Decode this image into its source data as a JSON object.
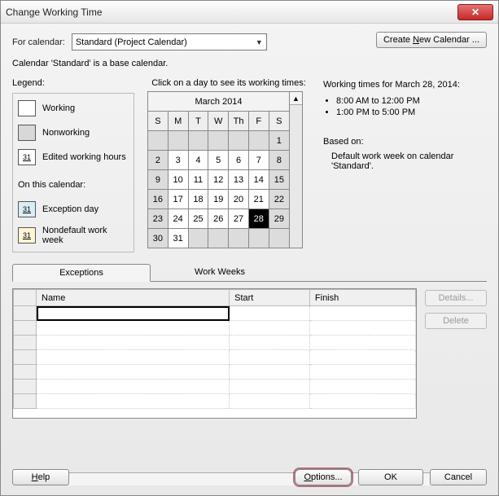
{
  "window": {
    "title": "Change Working Time"
  },
  "for_calendar_label": "For calendar:",
  "calendar_selected": "Standard (Project Calendar)",
  "create_calendar_label": "Create New Calendar ...",
  "base_text": "Calendar 'Standard' is a base calendar.",
  "legend": {
    "title": "Legend:",
    "items": [
      {
        "label": "Working",
        "swatch": "working"
      },
      {
        "label": "Nonworking",
        "swatch": "nonworking"
      },
      {
        "label": "Edited working hours",
        "swatch": "edited",
        "num": "31"
      }
    ],
    "sub_title": "On this calendar:",
    "sub_items": [
      {
        "label": "Exception day",
        "swatch": "exc",
        "num": "31"
      },
      {
        "label": "Nondefault work week",
        "swatch": "nondef",
        "num": "31"
      }
    ]
  },
  "calendar": {
    "caption": "Click on a day to see its working times:",
    "month": "March 2014",
    "dow": [
      "S",
      "M",
      "T",
      "W",
      "Th",
      "F",
      "S"
    ],
    "rows": [
      [
        {
          "v": "",
          "o": 1
        },
        {
          "v": "",
          "o": 1
        },
        {
          "v": "",
          "o": 1
        },
        {
          "v": "",
          "o": 1
        },
        {
          "v": "",
          "o": 1
        },
        {
          "v": "",
          "o": 1
        },
        {
          "v": "1",
          "w": 1
        }
      ],
      [
        {
          "v": "2",
          "w": 1
        },
        {
          "v": "3"
        },
        {
          "v": "4"
        },
        {
          "v": "5"
        },
        {
          "v": "6"
        },
        {
          "v": "7"
        },
        {
          "v": "8",
          "w": 1
        }
      ],
      [
        {
          "v": "9",
          "w": 1
        },
        {
          "v": "10"
        },
        {
          "v": "11"
        },
        {
          "v": "12"
        },
        {
          "v": "13"
        },
        {
          "v": "14"
        },
        {
          "v": "15",
          "w": 1
        }
      ],
      [
        {
          "v": "16",
          "w": 1
        },
        {
          "v": "17"
        },
        {
          "v": "18"
        },
        {
          "v": "19"
        },
        {
          "v": "20"
        },
        {
          "v": "21"
        },
        {
          "v": "22",
          "w": 1
        }
      ],
      [
        {
          "v": "23",
          "w": 1
        },
        {
          "v": "24"
        },
        {
          "v": "25"
        },
        {
          "v": "26"
        },
        {
          "v": "27"
        },
        {
          "v": "28",
          "sel": 1
        },
        {
          "v": "29",
          "w": 1
        }
      ],
      [
        {
          "v": "30",
          "w": 1
        },
        {
          "v": "31"
        },
        {
          "v": "",
          "o": 1
        },
        {
          "v": "",
          "o": 1
        },
        {
          "v": "",
          "o": 1
        },
        {
          "v": "",
          "o": 1
        },
        {
          "v": "",
          "o": 1
        }
      ]
    ]
  },
  "times": {
    "heading": "Working times for March 28, 2014:",
    "slots": [
      "8:00 AM to 12:00 PM",
      "1:00 PM to 5:00 PM"
    ],
    "based_on_label": "Based on:",
    "based_on_text": "Default work week on calendar 'Standard'."
  },
  "tabs": {
    "exceptions": "Exceptions",
    "workweeks": "Work Weeks"
  },
  "table": {
    "cols": {
      "name": "Name",
      "start": "Start",
      "finish": "Finish"
    },
    "rows": [
      {
        "name": "",
        "start": "",
        "finish": ""
      },
      {
        "name": "",
        "start": "",
        "finish": ""
      },
      {
        "name": "",
        "start": "",
        "finish": ""
      },
      {
        "name": "",
        "start": "",
        "finish": ""
      },
      {
        "name": "",
        "start": "",
        "finish": ""
      },
      {
        "name": "",
        "start": "",
        "finish": ""
      },
      {
        "name": "",
        "start": "",
        "finish": ""
      }
    ]
  },
  "buttons": {
    "details": "Details...",
    "delete": "Delete",
    "help": "Help",
    "options": "Options...",
    "ok": "OK",
    "cancel": "Cancel"
  }
}
